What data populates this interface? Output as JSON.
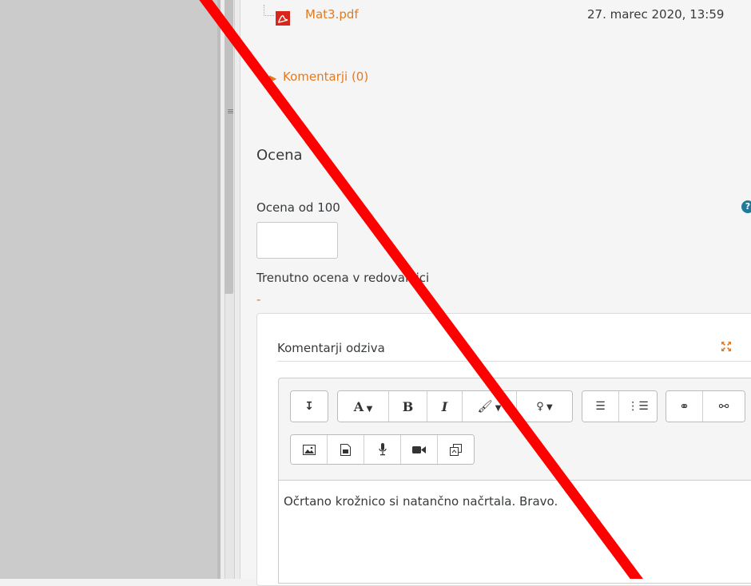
{
  "submission": {
    "file_name": "Mat3.pdf",
    "file_date": "27. marec 2020, 13:59",
    "comments_link": "Komentarji (0)"
  },
  "grade": {
    "heading": "Ocena",
    "grade_label": "Ocena od 100",
    "grade_value": "",
    "current_grade_label": "Trenutno ocena v redovalnici",
    "current_grade_value": "-"
  },
  "feedback": {
    "title": "Komentarji odziva",
    "editor_text": "Očrtano krožnico si natančno načrtala. Bravo.",
    "toolbar_icons": [
      "toggle-toolbar-icon",
      "font-style-icon",
      "bold-icon",
      "italic-icon",
      "text-color-icon",
      "accessibility-icon",
      "unordered-list-icon",
      "ordered-list-icon",
      "link-icon",
      "unlink-icon",
      "image-icon",
      "media-icon",
      "record-audio-icon",
      "record-video-icon",
      "manage-files-icon"
    ]
  },
  "colors": {
    "link": "#e07b22",
    "help": "#1f7a99",
    "annotation_slash": "#ff0000"
  }
}
